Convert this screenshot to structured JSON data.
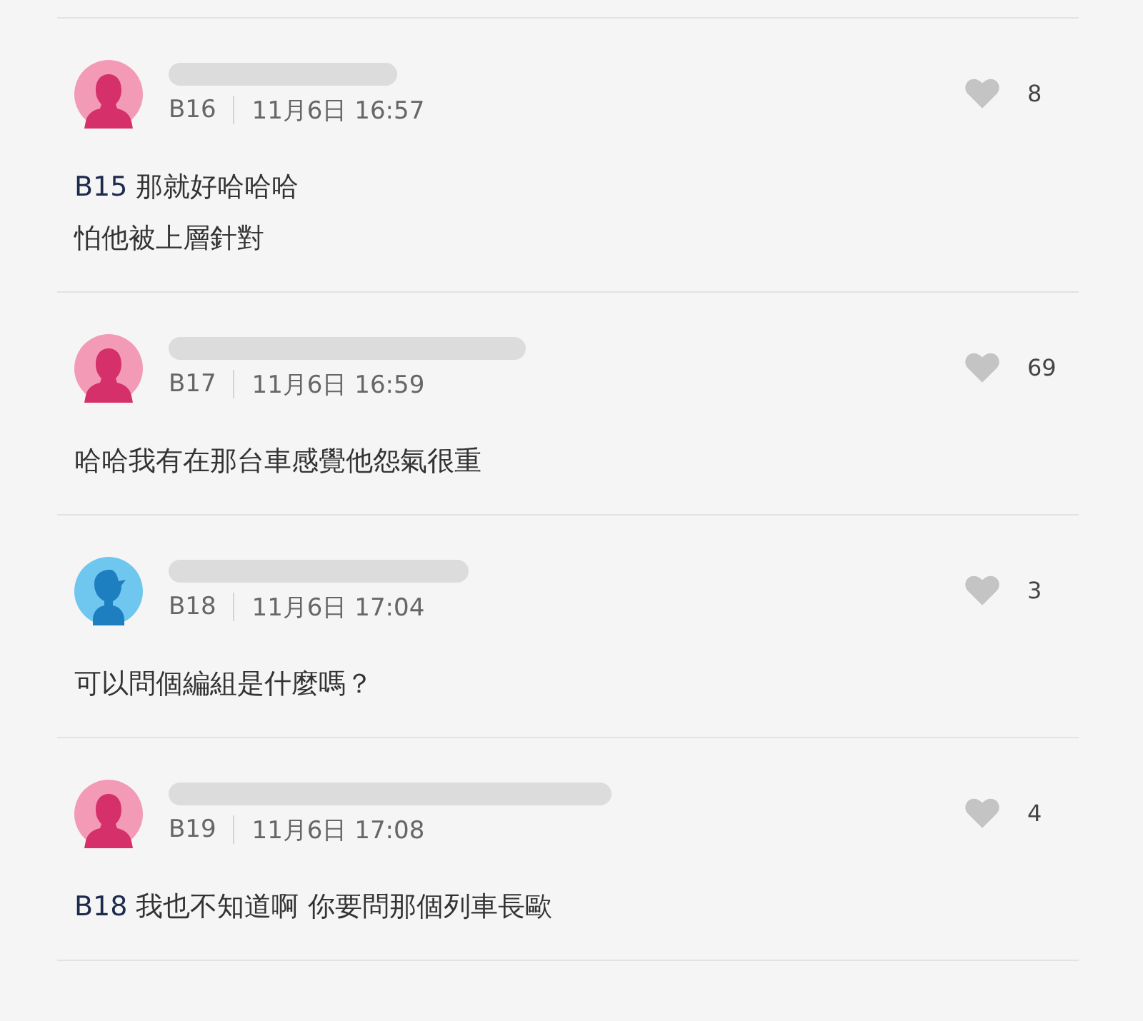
{
  "comments": [
    {
      "kind": "female",
      "floor": "B16",
      "time": "11月6日 16:57",
      "likes": "8",
      "lines": [
        {
          "mention": "B15",
          "text": "那就好哈哈哈"
        },
        {
          "text": "怕他被上層針對"
        }
      ]
    },
    {
      "kind": "female",
      "floor": "B17",
      "time": "11月6日 16:59",
      "likes": "69",
      "lines": [
        {
          "text": "哈哈我有在那台車感覺他怨氣很重"
        }
      ]
    },
    {
      "kind": "male",
      "floor": "B18",
      "time": "11月6日 17:04",
      "likes": "3",
      "lines": [
        {
          "text": "可以問個編組是什麼嗎？"
        }
      ]
    },
    {
      "kind": "female",
      "floor": "B19",
      "time": "11月6日 17:08",
      "likes": "4",
      "lines": [
        {
          "mention": "B18",
          "text": "我也不知道啊 你要問那個列車長歐"
        }
      ]
    }
  ]
}
